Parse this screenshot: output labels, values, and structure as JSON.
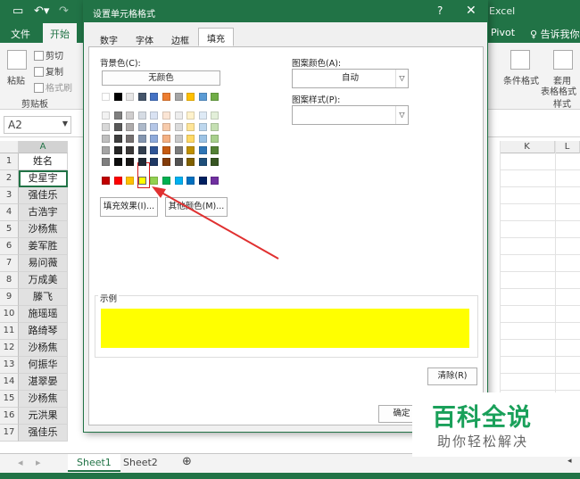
{
  "excel": {
    "app_title": "Excel",
    "ribbon_tabs": [
      "文件",
      "开始"
    ],
    "ribbon_right_tab": "Pivot",
    "tell_me": "告诉我你想",
    "clipboard": {
      "paste": "粘贴",
      "cut": "剪切",
      "copy": "复制",
      "format_painter": "格式刷",
      "group": "剪贴板"
    },
    "styles": {
      "conditional": "条件格式",
      "table_format_1": "套用",
      "table_format_2": "表格格式",
      "group": "样式"
    },
    "name_box": "A2",
    "columns": [
      "A",
      "K",
      "L"
    ],
    "rows": [
      {
        "num": "1",
        "value": "姓名"
      },
      {
        "num": "2",
        "value": "史星宇"
      },
      {
        "num": "3",
        "value": "强佳乐"
      },
      {
        "num": "4",
        "value": "古浩宇"
      },
      {
        "num": "5",
        "value": "沙杨焦"
      },
      {
        "num": "6",
        "value": "姜军胜"
      },
      {
        "num": "7",
        "value": "易问薇"
      },
      {
        "num": "8",
        "value": "万成美"
      },
      {
        "num": "9",
        "value": "滕飞"
      },
      {
        "num": "10",
        "value": "施瑶瑶"
      },
      {
        "num": "11",
        "value": "路绮琴"
      },
      {
        "num": "12",
        "value": "沙杨焦"
      },
      {
        "num": "13",
        "value": "何振华"
      },
      {
        "num": "14",
        "value": "湛翠晏"
      },
      {
        "num": "15",
        "value": "沙杨焦"
      },
      {
        "num": "16",
        "value": "元洪果"
      },
      {
        "num": "17",
        "value": "强佳乐"
      }
    ],
    "sheets": [
      "Sheet1",
      "Sheet2"
    ],
    "add_sheet": "⊕"
  },
  "dialog": {
    "title": "设置单元格格式",
    "help": "?",
    "close": "✕",
    "tabs": [
      "数字",
      "字体",
      "边框",
      "填充"
    ],
    "active_tab": "填充",
    "bg_color_label": "背景色(C):",
    "no_color": "无颜色",
    "fill_effects": "填充效果(I)...",
    "more_colors": "其他颜色(M)...",
    "pattern_color_label": "图案颜色(A):",
    "pattern_color_value": "自动",
    "pattern_style_label": "图案样式(P):",
    "pattern_style_value": "",
    "sample_label": "示例",
    "sample_color": "#FFFF00",
    "clear": "清除(R)",
    "ok": "确定",
    "palette": {
      "theme_top": [
        "#FFFFFF",
        "#000000",
        "#E7E6E6",
        "#44546A",
        "#4472C4",
        "#ED7D31",
        "#A5A5A5",
        "#FFC000",
        "#5B9BD5",
        "#70AD47"
      ],
      "theme_shades": [
        [
          "#F2F2F2",
          "#7F7F7F",
          "#D0CECE",
          "#D6DCE4",
          "#D9E2F3",
          "#FBE5D5",
          "#EDEDED",
          "#FFF2CC",
          "#DEEAF6",
          "#E2EFD9"
        ],
        [
          "#D8D8D8",
          "#595959",
          "#AEABAB",
          "#ADB9CA",
          "#B4C6E7",
          "#F7CBAC",
          "#DBDBDB",
          "#FFE598",
          "#BDD7EE",
          "#C5E0B3"
        ],
        [
          "#BFBFBF",
          "#3F3F3F",
          "#757070",
          "#8496B0",
          "#8EAADB",
          "#F4B083",
          "#C9C9C9",
          "#FFD965",
          "#9CC3E5",
          "#A8D08D"
        ],
        [
          "#A5A5A5",
          "#262626",
          "#3A3838",
          "#323F4F",
          "#2F5496",
          "#C55A11",
          "#7B7B7B",
          "#BF9000",
          "#2E75B5",
          "#538135"
        ],
        [
          "#7F7F7F",
          "#0C0C0C",
          "#171616",
          "#222A35",
          "#1F3864",
          "#833C0B",
          "#525252",
          "#7F6000",
          "#1E4E79",
          "#375623"
        ]
      ],
      "standard": [
        "#C00000",
        "#FF0000",
        "#FFC000",
        "#FFFF00",
        "#92D050",
        "#00B050",
        "#00B0F0",
        "#0070C0",
        "#002060",
        "#7030A0"
      ],
      "selected_standard_index": 3
    }
  },
  "watermark": {
    "line1": "百科全说",
    "line2": "助你轻松解决"
  },
  "annotation": {
    "arrow_color": "#E03030"
  }
}
